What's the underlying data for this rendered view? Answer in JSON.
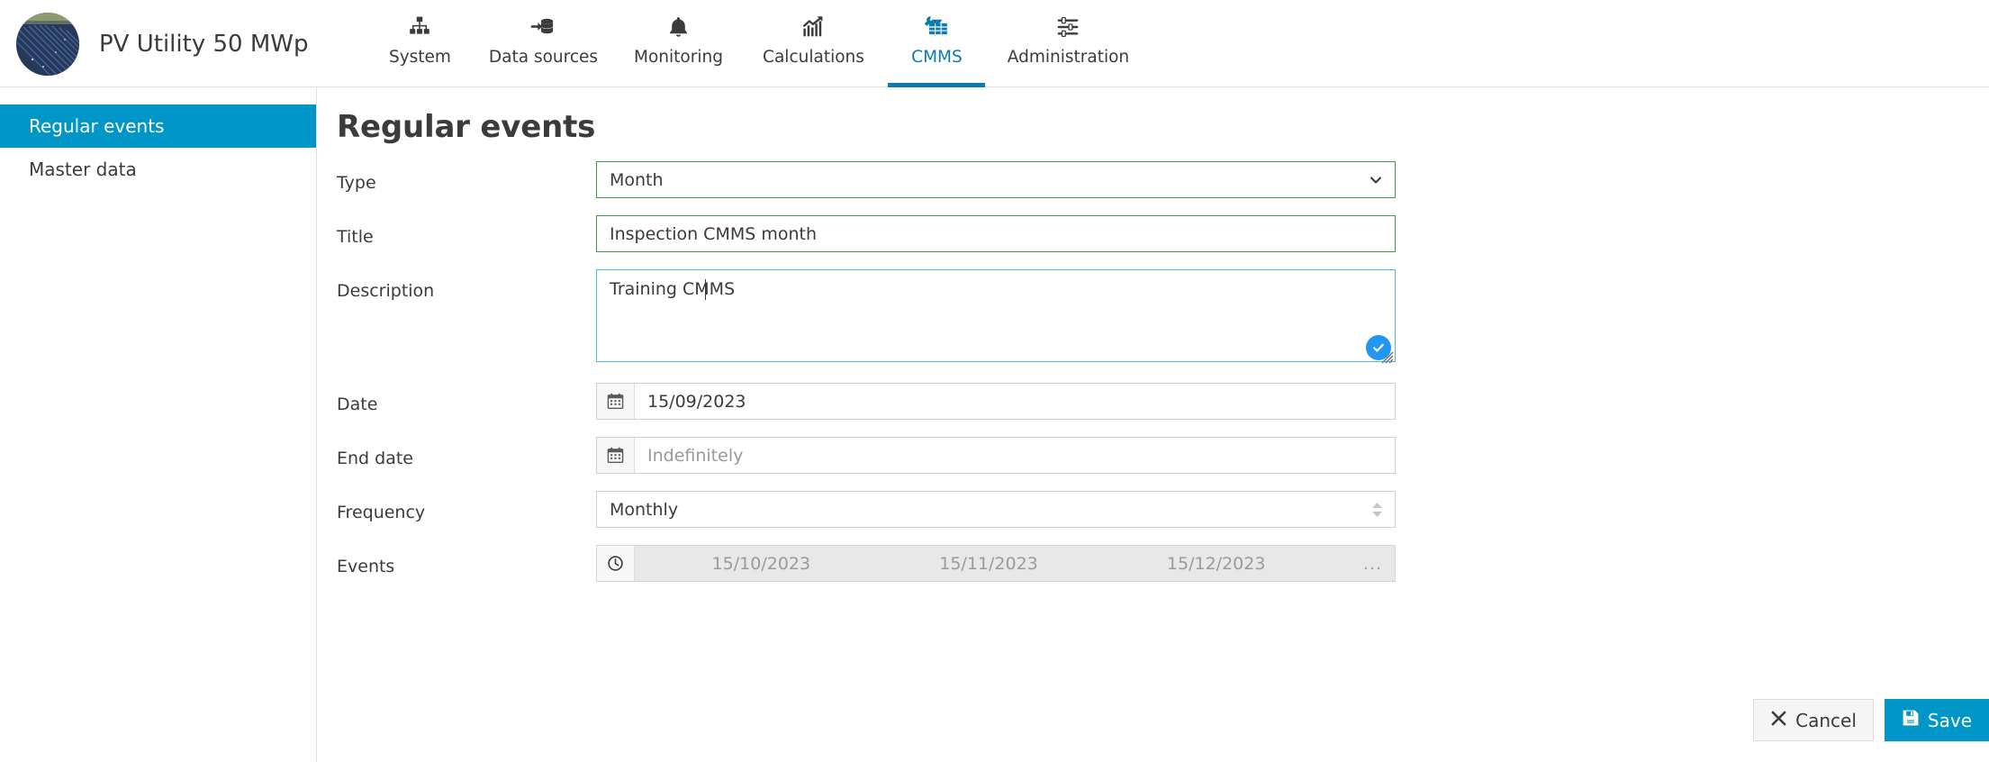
{
  "header": {
    "brand_title": "PV Utility 50 MWp",
    "logo_icon": "solar-farm-photo",
    "nav": [
      {
        "label": "System",
        "icon": "sitemap-icon",
        "active": false
      },
      {
        "label": "Data sources",
        "icon": "database-in-icon",
        "active": false
      },
      {
        "label": "Monitoring",
        "icon": "bell-icon",
        "active": false
      },
      {
        "label": "Calculations",
        "icon": "chart-up-icon",
        "active": false
      },
      {
        "label": "CMMS",
        "icon": "solar-wrench-icon",
        "active": true
      },
      {
        "label": "Administration",
        "icon": "sliders-icon",
        "active": false
      }
    ]
  },
  "sidebar": {
    "items": [
      {
        "label": "Regular events",
        "active": true
      },
      {
        "label": "Master data",
        "active": false
      }
    ]
  },
  "main": {
    "page_title": "Regular events",
    "fields": {
      "type": {
        "label": "Type",
        "value": "Month",
        "icon": "chevron-down-icon"
      },
      "title": {
        "label": "Title",
        "value": "Inspection CMMS month"
      },
      "description": {
        "label": "Description",
        "value": "Training CMMS",
        "badge_icon": "check-circle-icon"
      },
      "date": {
        "label": "Date",
        "value": "15/09/2023",
        "placeholder": "",
        "icon": "calendar-icon"
      },
      "end_date": {
        "label": "End date",
        "value": "",
        "placeholder": "Indefinitely",
        "icon": "calendar-icon"
      },
      "frequency": {
        "label": "Frequency",
        "value": "Monthly",
        "icon": "spinner-updown-icon"
      },
      "events": {
        "label": "Events",
        "icon": "clock-icon",
        "items": [
          "15/10/2023",
          "15/11/2023",
          "15/12/2023"
        ],
        "more": "..."
      }
    },
    "footer": {
      "cancel_label": "Cancel",
      "cancel_icon": "close-x-icon",
      "save_label": "Save",
      "save_icon": "floppy-save-icon"
    }
  },
  "colors": {
    "accent_blue": "#0096c8",
    "active_tab_blue": "#0b7cb0",
    "valid_green": "#3c9c46",
    "focus_blue": "#4bb8e8",
    "badge_blue": "#2196f3"
  }
}
